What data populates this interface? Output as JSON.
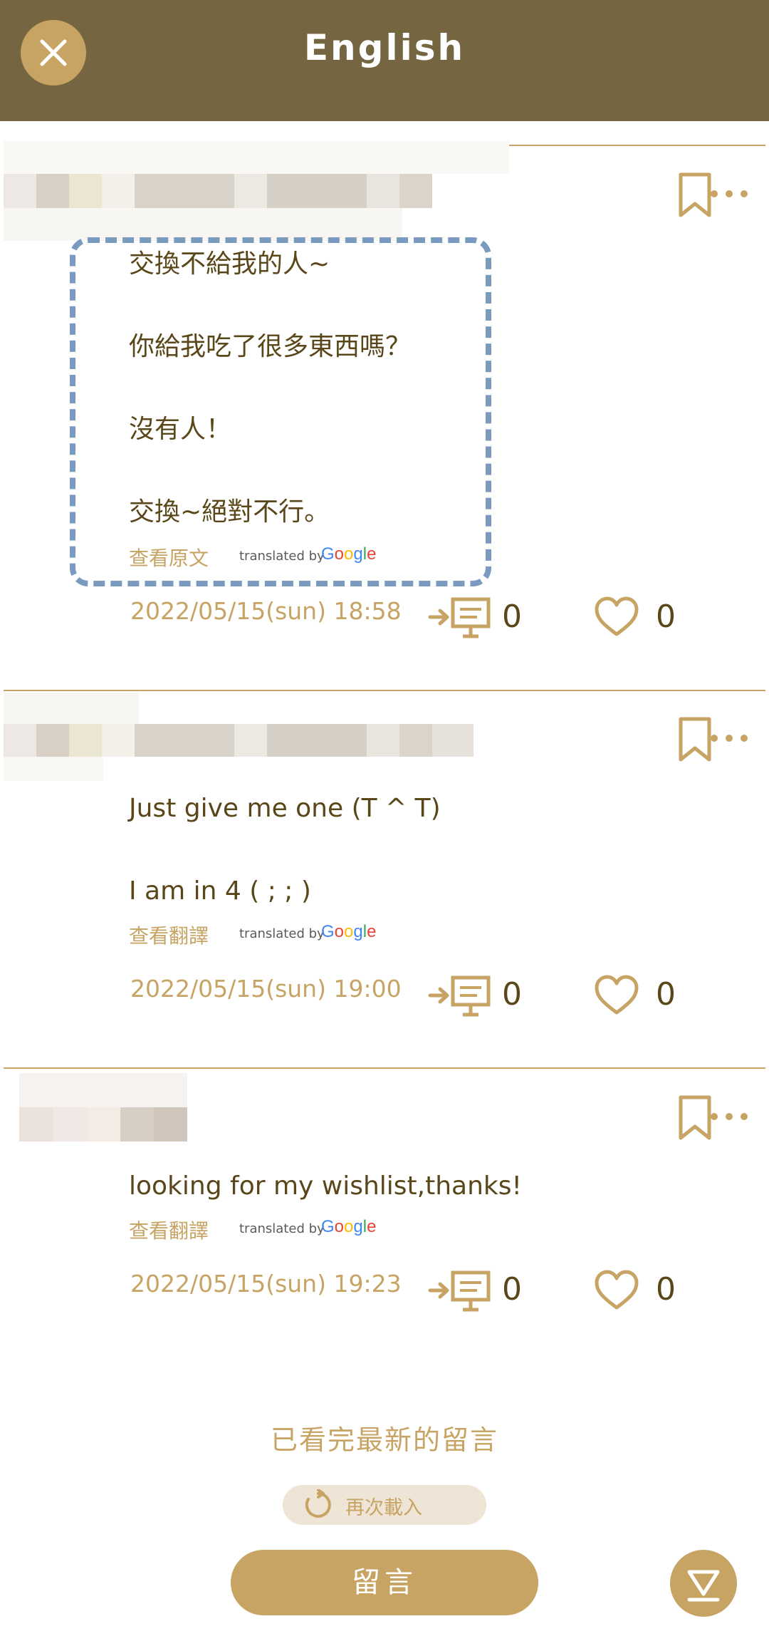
{
  "header": {
    "title": "English"
  },
  "posts": [
    {
      "text": "交換不給我的人~\n\n你給我吃了很多東西嗎？\n\n沒有人！\n\n交換~絕對不行。",
      "translate_link": "查看原文",
      "translated_by": "translated by",
      "google": "Google",
      "timestamp": "2022/05/15(sun) 18:58",
      "reply_count": "0",
      "like_count": "0"
    },
    {
      "text": "Just give me one (T ^ T)\n\nI am in 4 ( ; ; )",
      "translate_link": "查看翻譯",
      "translated_by": "translated by",
      "google": "Google",
      "timestamp": "2022/05/15(sun) 19:00",
      "reply_count": "0",
      "like_count": "0"
    },
    {
      "text": "looking for my wishlist,thanks!",
      "translate_link": "查看翻譯",
      "translated_by": "translated by",
      "google": "Google",
      "timestamp": "2022/05/15(sun) 19:23",
      "reply_count": "0",
      "like_count": "0"
    }
  ],
  "footer": {
    "end_message": "已看完最新的留言",
    "reload_label": "再次載入",
    "comment_button": "留言"
  },
  "colors": {
    "header_bg": "#756641",
    "accent": "#c7a464",
    "text": "#5a4719",
    "highlight": "#7a9ac0"
  },
  "icons": [
    "close-icon",
    "bookmark-icon",
    "more-icon",
    "reply-icon",
    "heart-icon",
    "reload-icon",
    "scroll-down-icon"
  ]
}
